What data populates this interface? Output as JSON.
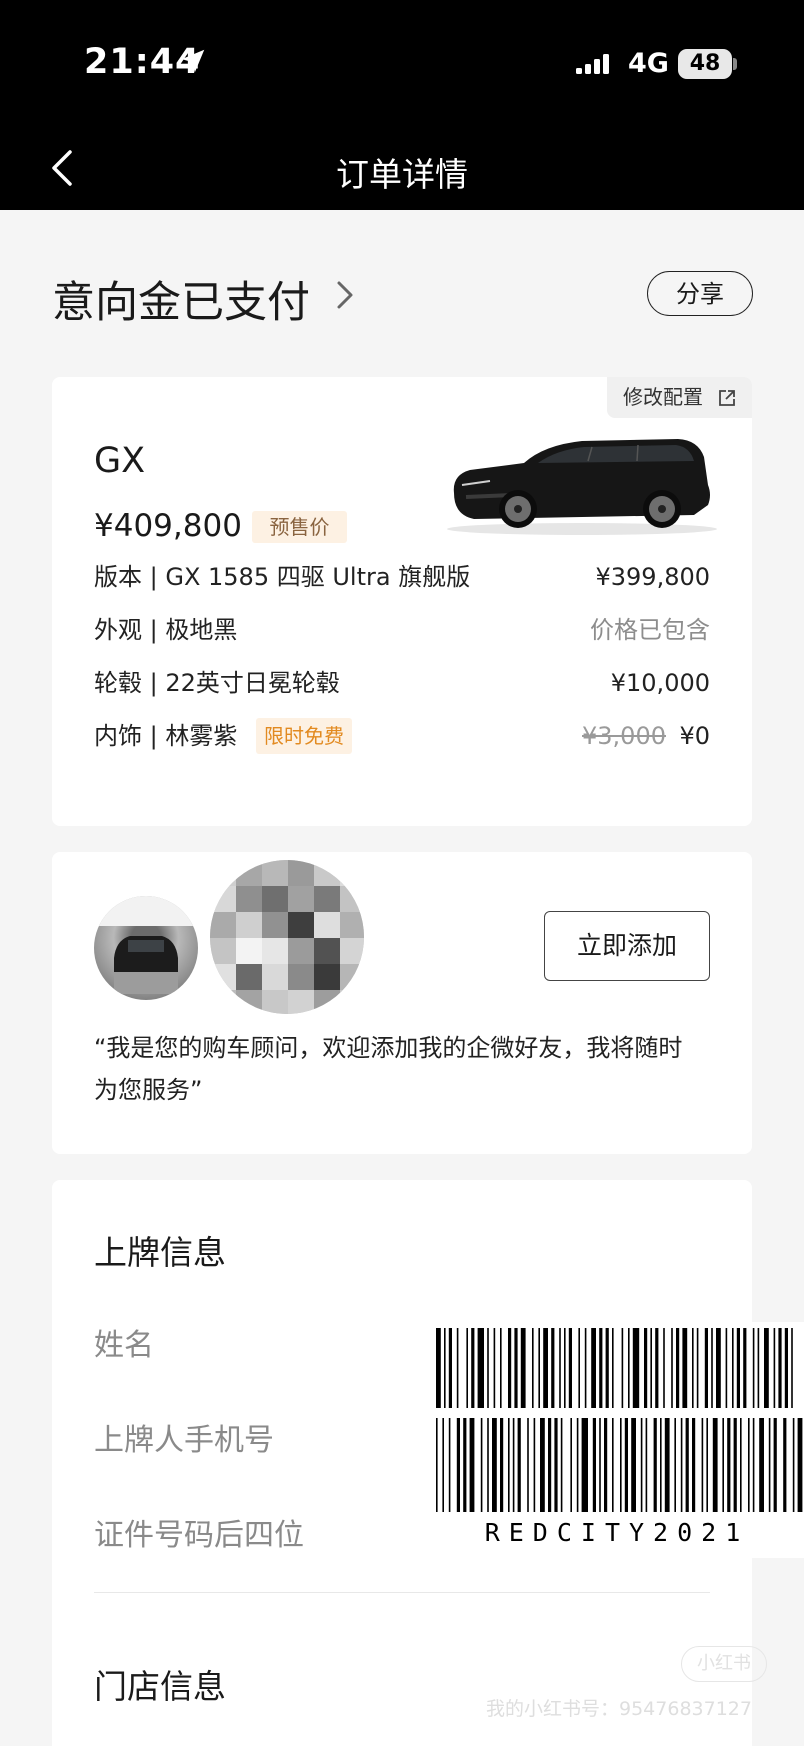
{
  "status_bar": {
    "time": "21:44",
    "network": "4G",
    "battery": "48"
  },
  "nav": {
    "title": "订单详情"
  },
  "order": {
    "status_title": "意向金已支付",
    "share_label": "分享"
  },
  "vehicle": {
    "modify_label": "修改配置",
    "model": "GX",
    "price": "¥409,800",
    "price_tag": "预售价",
    "rows": [
      {
        "name": "版本 | GX 1585 四驱 Ultra 旗舰版",
        "value": "¥399,800"
      },
      {
        "name": "外观 | 极地黑",
        "value": "价格已包含"
      },
      {
        "name": "轮毂 | 22英寸日冕轮毂",
        "value": "¥10,000"
      },
      {
        "name": "内饰 | 林雾紫",
        "tag": "限时免费",
        "original": "¥3,000",
        "value": "¥0"
      }
    ]
  },
  "advisor": {
    "add_label": "立即添加",
    "quote": "“我是您的购车顾问，欢迎添加我的企微好友，我将随时为您服务”"
  },
  "plate_info": {
    "title": "上牌信息",
    "fields": [
      "姓名",
      "上牌人手机号",
      "证件号码后四位"
    ]
  },
  "store_info": {
    "title": "门店信息"
  },
  "overlay": {
    "barcode_text": "REDCITY2021",
    "watermark_logo": "小红书",
    "watermark_text": "我的小红书号：95476837127"
  },
  "colors": {
    "accent_tag_bg": "#fdf1e3",
    "accent_orange": "#e28a20"
  },
  "icons": [
    "location-arrow-icon",
    "signal-icon",
    "back-chevron-icon",
    "chevron-right-icon",
    "external-link-icon"
  ]
}
